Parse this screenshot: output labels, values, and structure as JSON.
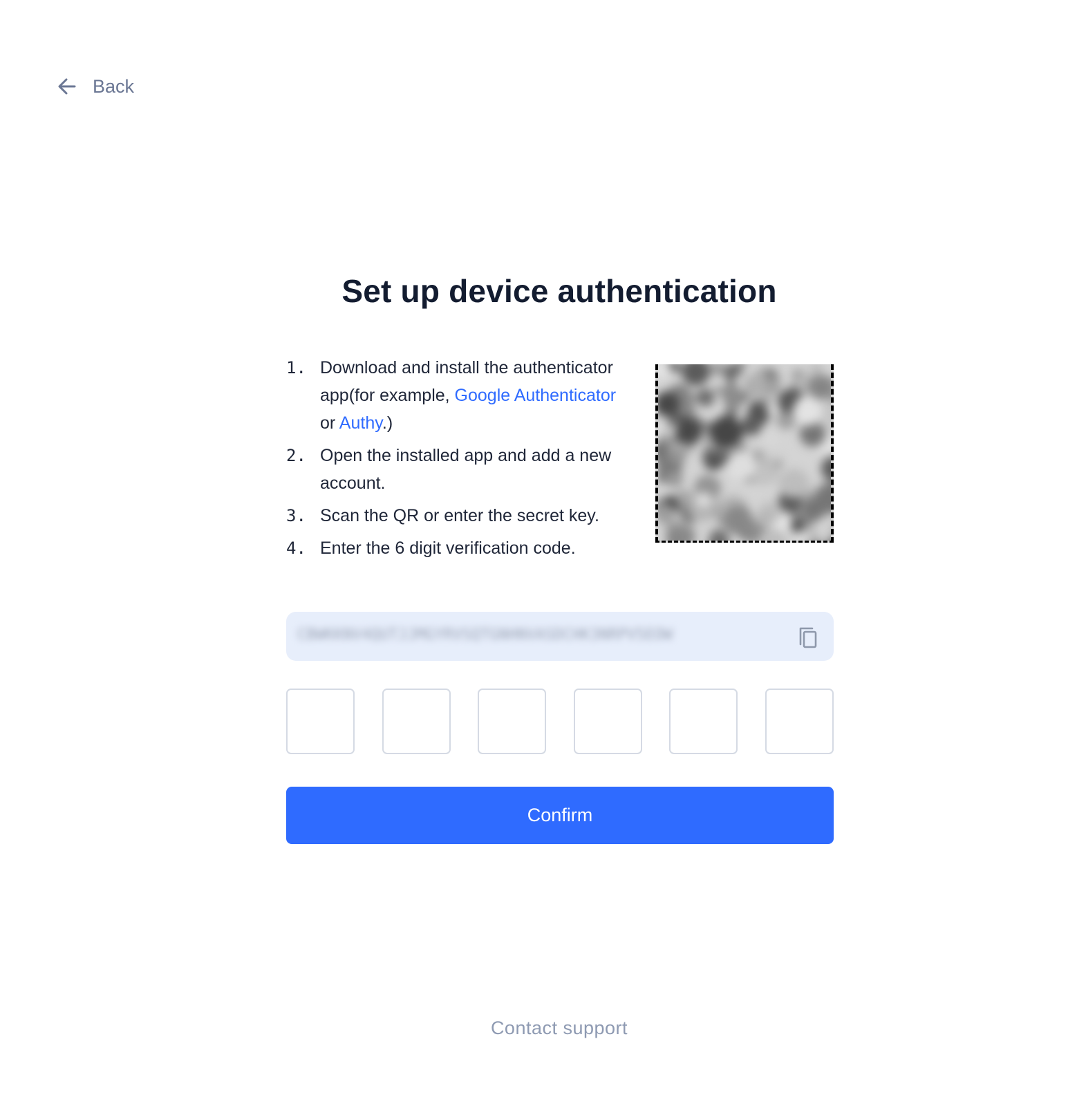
{
  "nav": {
    "back_label": "Back"
  },
  "page": {
    "title": "Set up device authentication"
  },
  "steps": [
    {
      "num": "1.",
      "text_before": "Download and install the authenticator app(for example, ",
      "link1": "Google Authenticator",
      "middle": " or ",
      "link2": "Authy",
      "text_after": ".)"
    },
    {
      "num": "2.",
      "text": "Open the installed app and add a new account."
    },
    {
      "num": "3.",
      "text": "Scan the QR or enter the secret key."
    },
    {
      "num": "4.",
      "text": "Enter the 6 digit verification code."
    }
  ],
  "secret": {
    "value": "CBWKKNV4QUTJJMGYRVSQTGNHNVASDCHK3NRPV5EOW"
  },
  "code": {
    "digits": [
      "",
      "",
      "",
      "",
      "",
      ""
    ]
  },
  "actions": {
    "confirm_label": "Confirm",
    "support_label": "Contact support"
  },
  "colors": {
    "accent": "#2f6bff",
    "secret_bg": "#e7eefb",
    "muted": "#8e9ab2"
  },
  "icons": {
    "back": "arrow-left-icon",
    "copy": "copy-icon",
    "qr": "qr-code"
  }
}
